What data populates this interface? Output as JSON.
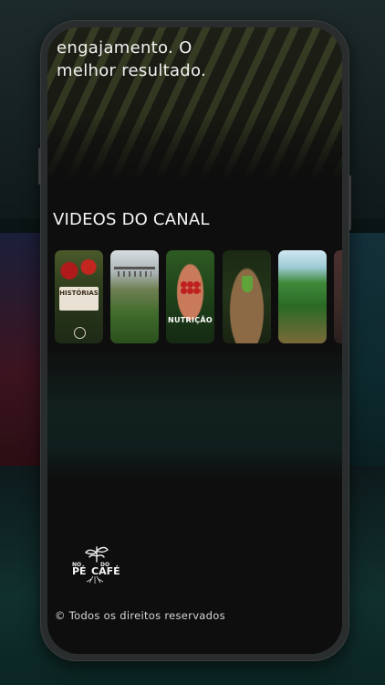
{
  "hero": {
    "text_line1": "engajamento. O",
    "text_line2": "melhor resultado."
  },
  "videos_section": {
    "title": "VIDEOS DO CANAL",
    "thumbnails": [
      {
        "name": "video-historias",
        "label": "HISTÓRIAS"
      },
      {
        "name": "video-irrigation",
        "label": ""
      },
      {
        "name": "video-nutricao",
        "label": "NUTRIÇÃO"
      },
      {
        "name": "video-seedling",
        "label": ""
      },
      {
        "name": "video-coffee-rows",
        "label": ""
      },
      {
        "name": "video-partial",
        "label": ""
      }
    ]
  },
  "footer": {
    "logo_text": "NO PÉ DO CAFÉ",
    "copyright": "© Todos os direitos reservados"
  },
  "colors": {
    "screen_background": "#0e0e0e",
    "text_primary": "#f2f2f2"
  }
}
